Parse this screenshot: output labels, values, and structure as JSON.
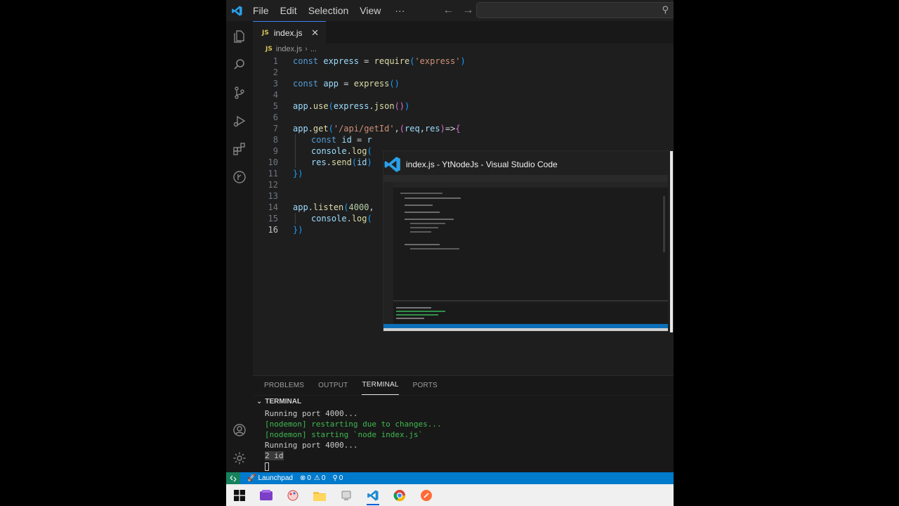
{
  "menu": {
    "file": "File",
    "edit": "Edit",
    "selection": "Selection",
    "view": "View",
    "more": "···"
  },
  "tab": {
    "badge": "JS",
    "label": "index.js",
    "close": "✕"
  },
  "breadcrumb": {
    "badge": "JS",
    "file": "index.js",
    "sep": "›",
    "rest": "..."
  },
  "code": [
    {
      "n": "1",
      "t": "const express = require('express')"
    },
    {
      "n": "2",
      "t": ""
    },
    {
      "n": "3",
      "t": "const app = express()"
    },
    {
      "n": "4",
      "t": ""
    },
    {
      "n": "5",
      "t": "app.use(express.json())"
    },
    {
      "n": "6",
      "t": ""
    },
    {
      "n": "7",
      "t": "app.get('/api/getId',(req,res)=>{"
    },
    {
      "n": "8",
      "t": "const id = r"
    },
    {
      "n": "9",
      "t": "console.log("
    },
    {
      "n": "10",
      "t": "res.send(id)"
    },
    {
      "n": "11",
      "t": "})"
    },
    {
      "n": "12",
      "t": ""
    },
    {
      "n": "13",
      "t": ""
    },
    {
      "n": "14",
      "t": "app.listen(4000,"
    },
    {
      "n": "15",
      "t": "console.log("
    },
    {
      "n": "16",
      "t": "})"
    }
  ],
  "preview": {
    "title": "index.js - YtNodeJs - Visual Studio Code"
  },
  "panel": {
    "problems": "PROBLEMS",
    "output": "OUTPUT",
    "terminal": "TERMINAL",
    "ports": "PORTS",
    "section": "TERMINAL"
  },
  "terminal": [
    "Running port 4000...",
    "[nodemon] restarting due to changes...",
    "[nodemon] starting `node index.js`",
    "Running port 4000...",
    "2 id"
  ],
  "status": {
    "launchpad": "Launchpad",
    "errors": "0",
    "warnings": "0",
    "ports": "0"
  },
  "colors": {
    "accent": "#007acc",
    "remote": "#16825d",
    "editor_bg": "#1e1e1e",
    "terminal_green": "#3fb950"
  }
}
